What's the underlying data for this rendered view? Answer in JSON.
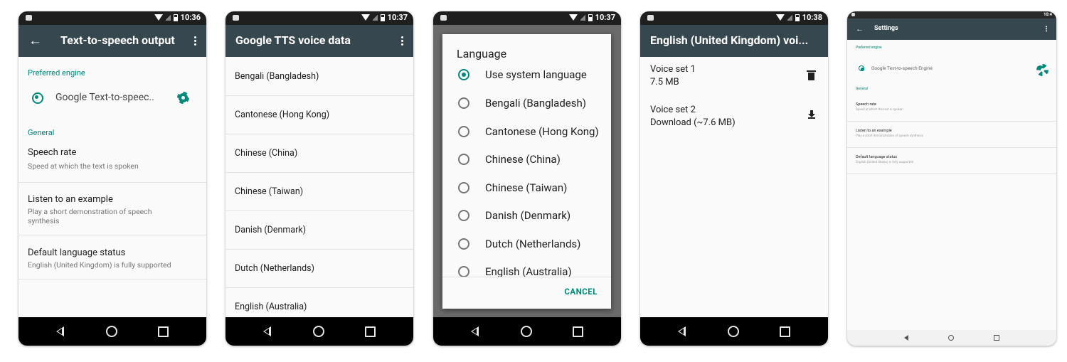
{
  "colors": {
    "toolbar": "#37474f",
    "accent": "#00897b",
    "statusbar": "#1f1f1f",
    "navbar": "#000000"
  },
  "screens": [
    {
      "time": "10:36",
      "title": "Text-to-speech output",
      "preferred_engine_label": "Preferred engine",
      "engine_name": "Google Text-to-speec..",
      "general_label": "General",
      "prefs": [
        {
          "title": "Speech rate",
          "summary": "Speed at which the text is spoken"
        },
        {
          "title": "Listen to an example",
          "summary": "Play a short demonstration of speech synthesis"
        },
        {
          "title": "Default language status",
          "summary": "English (United Kingdom) is fully supported"
        }
      ]
    },
    {
      "time": "10:37",
      "title": "Google TTS voice data",
      "languages": [
        "Bengali (Bangladesh)",
        "Cantonese (Hong Kong)",
        "Chinese (China)",
        "Chinese (Taiwan)",
        "Danish (Denmark)",
        "Dutch (Netherlands)",
        "English (Australia)"
      ]
    },
    {
      "time": "10:37",
      "dialog_title": "Language",
      "options": [
        "Use system language",
        "Bengali (Bangladesh)",
        "Cantonese (Hong Kong)",
        "Chinese (China)",
        "Chinese (Taiwan)",
        "Danish (Denmark)",
        "Dutch (Netherlands)",
        "English (Australia)"
      ],
      "selected_index": 0,
      "cancel_label": "CANCEL"
    },
    {
      "time": "10:38",
      "title": "English (United Kingdom) voi...",
      "voices": [
        {
          "name": "Voice set 1",
          "detail": "7.5 MB",
          "action_icon": "delete-icon"
        },
        {
          "name": "Voice set 2",
          "detail": "Download (~7.6 MB)",
          "action_icon": "download-icon"
        }
      ]
    },
    {
      "time": "10:4",
      "title": "Settings",
      "preferred_engine_label": "Preferred engine",
      "engine_name": "Google Text-to-speech Engine",
      "general_label": "General",
      "prefs": [
        {
          "title": "Speech rate",
          "summary": "Speed at which the text is spoken"
        },
        {
          "title": "Listen to an example",
          "summary": "Play a short demonstration of speech synthesis"
        },
        {
          "title": "Default language status",
          "summary": "English (United States) is fully supported"
        }
      ]
    }
  ]
}
